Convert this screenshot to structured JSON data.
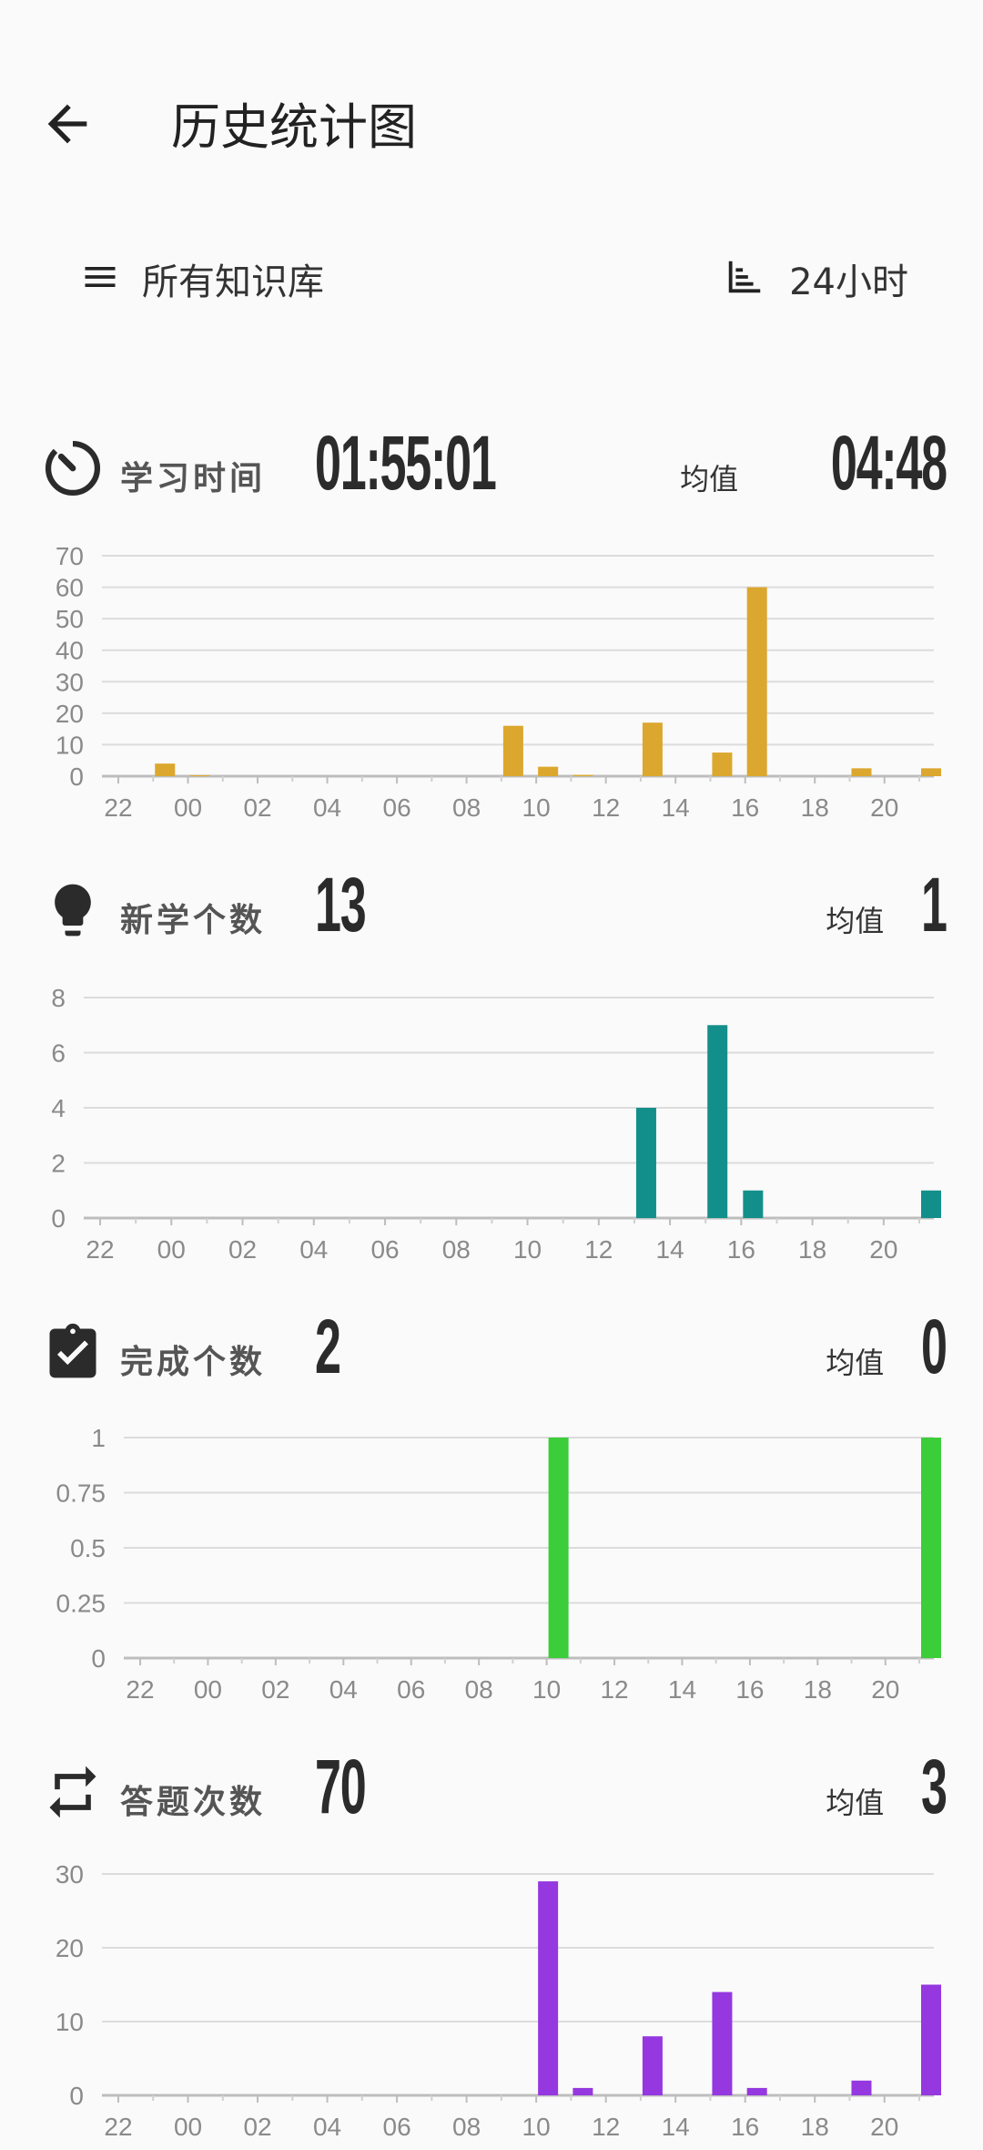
{
  "appbar": {
    "title": "历史统计图"
  },
  "toolbar": {
    "filter_label": "所有知识库",
    "range_label": "24小时"
  },
  "x_ticks": [
    "22",
    "00",
    "02",
    "04",
    "06",
    "08",
    "10",
    "12",
    "14",
    "16",
    "18",
    "20"
  ],
  "hours": [
    "22",
    "23",
    "00",
    "01",
    "02",
    "03",
    "04",
    "05",
    "06",
    "07",
    "08",
    "09",
    "10",
    "11",
    "12",
    "13",
    "14",
    "15",
    "16",
    "17",
    "18",
    "19",
    "20",
    "21"
  ],
  "sections": {
    "study_time": {
      "label": "学习时间",
      "value": "01:55:01",
      "avg_label": "均值",
      "avg_value": "04:48",
      "icon": "timer-icon"
    },
    "new_learned": {
      "label": "新学个数",
      "value": "13",
      "avg_label": "均值",
      "avg_value": "1",
      "icon": "lightbulb-icon"
    },
    "completed": {
      "label": "完成个数",
      "value": "2",
      "avg_label": "均值",
      "avg_value": "0",
      "icon": "clipboard-check-icon"
    },
    "answers": {
      "label": "答题次数",
      "value": "70",
      "avg_label": "均值",
      "avg_value": "3",
      "icon": "repeat-icon"
    }
  },
  "chart_data": [
    {
      "type": "bar",
      "color": "#dca72e",
      "ylim": [
        0,
        70
      ],
      "yticks": [
        "0",
        "10",
        "20",
        "30",
        "40",
        "50",
        "60",
        "70"
      ],
      "x": [
        "22",
        "23",
        "00",
        "01",
        "02",
        "03",
        "04",
        "05",
        "06",
        "07",
        "08",
        "09",
        "10",
        "11",
        "12",
        "13",
        "14",
        "15",
        "16",
        "17",
        "18",
        "19",
        "20",
        "21"
      ],
      "values": [
        0,
        4,
        0.3,
        0,
        0,
        0,
        0,
        0,
        0,
        0,
        0,
        16,
        3,
        0.4,
        0,
        17,
        0,
        7.5,
        60,
        0,
        0,
        2.5,
        0,
        2.5
      ]
    },
    {
      "type": "bar",
      "color": "#138f8b",
      "ylim": [
        0,
        8
      ],
      "yticks": [
        "0",
        "2",
        "4",
        "6",
        "8"
      ],
      "x": [
        "22",
        "23",
        "00",
        "01",
        "02",
        "03",
        "04",
        "05",
        "06",
        "07",
        "08",
        "09",
        "10",
        "11",
        "12",
        "13",
        "14",
        "15",
        "16",
        "17",
        "18",
        "19",
        "20",
        "21"
      ],
      "values": [
        0,
        0,
        0,
        0,
        0,
        0,
        0,
        0,
        0,
        0,
        0,
        0,
        0,
        0,
        0,
        4,
        0,
        7,
        1,
        0,
        0,
        0,
        0,
        1
      ]
    },
    {
      "type": "bar",
      "color": "#3ccd3a",
      "ylim": [
        0,
        1
      ],
      "yticks": [
        "0",
        "0.25",
        "0.5",
        "0.75",
        "1"
      ],
      "x": [
        "22",
        "23",
        "00",
        "01",
        "02",
        "03",
        "04",
        "05",
        "06",
        "07",
        "08",
        "09",
        "10",
        "11",
        "12",
        "13",
        "14",
        "15",
        "16",
        "17",
        "18",
        "19",
        "20",
        "21"
      ],
      "values": [
        0,
        0,
        0,
        0,
        0,
        0,
        0,
        0,
        0,
        0,
        0,
        0,
        1,
        0,
        0,
        0,
        0,
        0,
        0,
        0,
        0,
        0,
        0,
        1
      ]
    },
    {
      "type": "bar",
      "color": "#9538e0",
      "ylim": [
        0,
        30
      ],
      "yticks": [
        "0",
        "10",
        "20",
        "30"
      ],
      "x": [
        "22",
        "23",
        "00",
        "01",
        "02",
        "03",
        "04",
        "05",
        "06",
        "07",
        "08",
        "09",
        "10",
        "11",
        "12",
        "13",
        "14",
        "15",
        "16",
        "17",
        "18",
        "19",
        "20",
        "21"
      ],
      "values": [
        0,
        0,
        0,
        0,
        0,
        0,
        0,
        0,
        0,
        0,
        0,
        0,
        29,
        1,
        0,
        8,
        0,
        14,
        1,
        0,
        0,
        2,
        0,
        15
      ]
    }
  ]
}
